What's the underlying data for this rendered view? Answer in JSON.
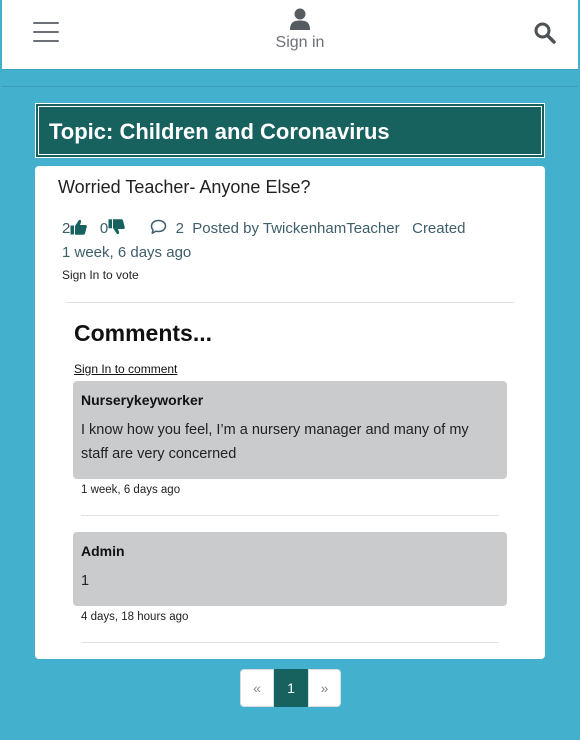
{
  "header": {
    "signin_label": "Sign in"
  },
  "topic": {
    "title": "Topic: Children and Coronavirus"
  },
  "post": {
    "title": "Worried Teacher- Anyone Else?",
    "likes": "2",
    "dislikes": "0",
    "comment_count": "2",
    "posted_by": "Posted by TwickenhamTeacher",
    "created_label": "Created",
    "created_ago": "1 week, 6 days ago",
    "vote_prompt": "Sign In to vote"
  },
  "comments": {
    "heading": "Comments...",
    "signin_prompt": "Sign In to comment",
    "items": [
      {
        "author": "Nurserykeyworker",
        "text": "I know how you feel, I’m a nursery manager and many of my staff are very concerned",
        "time": "1 week, 6 days ago"
      },
      {
        "author": "Admin",
        "text": "1",
        "time": "4 days, 18 hours ago"
      }
    ]
  },
  "pagination": {
    "prev": "«",
    "current": "1",
    "next": "»"
  },
  "colors": {
    "background": "#43b0ce",
    "accent": "#17615f"
  },
  "icons": [
    "hamburger-menu-icon",
    "user-icon",
    "search-icon",
    "thumbs-up-icon",
    "thumbs-down-icon",
    "comment-icon"
  ]
}
